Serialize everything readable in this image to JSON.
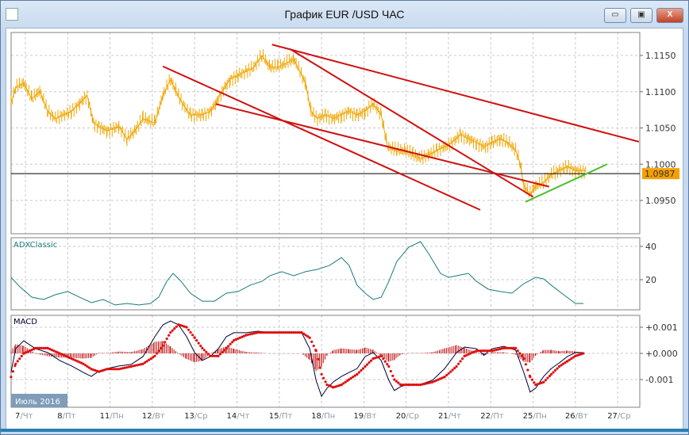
{
  "window": {
    "title": "График EUR /USD  ЧАС",
    "minimize": "▭",
    "maximize": "▣",
    "close": "X"
  },
  "month_label": "Июль 2016",
  "x_axis": [
    {
      "d": 0,
      "day": "7",
      "wd": "/Чт"
    },
    {
      "d": 1,
      "day": "8",
      "wd": "/Пт"
    },
    {
      "d": 2,
      "day": "11",
      "wd": "/Пн"
    },
    {
      "d": 3,
      "day": "12",
      "wd": "/Вт"
    },
    {
      "d": 4,
      "day": "13",
      "wd": "/Ср"
    },
    {
      "d": 5,
      "day": "14",
      "wd": "/Чт"
    },
    {
      "d": 6,
      "day": "15",
      "wd": "/Пт"
    },
    {
      "d": 7,
      "day": "18",
      "wd": "/Пн"
    },
    {
      "d": 8,
      "day": "19",
      "wd": "/Вт"
    },
    {
      "d": 9,
      "day": "20",
      "wd": "/Ср"
    },
    {
      "d": 10,
      "day": "21",
      "wd": "/Чт"
    },
    {
      "d": 11,
      "day": "22",
      "wd": "/Пт"
    },
    {
      "d": 12,
      "day": "25",
      "wd": "/Пн"
    },
    {
      "d": 13,
      "day": "26",
      "wd": "/Вт"
    },
    {
      "d": 14,
      "day": "27",
      "wd": "/Ср"
    }
  ],
  "chart_data": [
    {
      "type": "line",
      "title": "EUR/USD H1",
      "ylim": [
        1.0915,
        1.1175
      ],
      "y_ticks": [
        "1.1150",
        "1.1100",
        "1.1050",
        "1.1000",
        "1.0950"
      ],
      "y_tick_values": [
        1.115,
        1.11,
        1.105,
        1.1,
        1.095
      ],
      "current_price": "1.0987",
      "current_value": 1.0987,
      "colors": {
        "price": "#f0a500",
        "trend": "#d01010",
        "support": "#4cc02c",
        "current": "#000000"
      },
      "x": [
        -0.34,
        -0.23,
        -0.04,
        0.15,
        0.34,
        0.53,
        0.71,
        0.9,
        1.09,
        1.28,
        1.46,
        1.61,
        1.74,
        1.93,
        2.21,
        2.4,
        2.59,
        2.78,
        3.06,
        3.25,
        3.43,
        3.56,
        3.71,
        3.9,
        4.18,
        4.37,
        4.5,
        4.65,
        4.84,
        5.03,
        5.22,
        5.4,
        5.59,
        5.78,
        5.97,
        6.15,
        6.34,
        6.49,
        6.62,
        6.75,
        6.9,
        7.09,
        7.28,
        7.47,
        7.65,
        7.84,
        8.03,
        8.22,
        8.41,
        8.56,
        8.78,
        8.97,
        9.16,
        9.34,
        9.53,
        9.72,
        9.91,
        10.09,
        10.28,
        10.47,
        10.66,
        10.84,
        11.03,
        11.22,
        11.41,
        11.59,
        11.69,
        11.78,
        11.93,
        12.06,
        12.25,
        12.43,
        12.62,
        12.81,
        13.0,
        13.25
      ],
      "y": [
        1.1084,
        1.1106,
        1.1112,
        1.109,
        1.1101,
        1.1073,
        1.1063,
        1.1068,
        1.1073,
        1.1084,
        1.1095,
        1.1057,
        1.1052,
        1.1046,
        1.1052,
        1.1035,
        1.1046,
        1.1063,
        1.1057,
        1.1095,
        1.1117,
        1.1101,
        1.1084,
        1.1068,
        1.1068,
        1.1073,
        1.1084,
        1.1101,
        1.1117,
        1.1123,
        1.1128,
        1.1134,
        1.115,
        1.1134,
        1.1134,
        1.1139,
        1.1145,
        1.1128,
        1.1112,
        1.1073,
        1.1063,
        1.1068,
        1.1063,
        1.1068,
        1.1073,
        1.1068,
        1.1073,
        1.1084,
        1.1068,
        1.1024,
        1.1019,
        1.1019,
        1.1013,
        1.1008,
        1.1013,
        1.1019,
        1.1024,
        1.103,
        1.1041,
        1.1035,
        1.103,
        1.1024,
        1.103,
        1.1035,
        1.103,
        1.1019,
        1.1002,
        1.097,
        1.0959,
        1.097,
        1.0975,
        1.0986,
        1.0991,
        1.0997,
        1.0991,
        1.0991
      ],
      "trendlines": [
        {
          "name": "resistance-1",
          "color": "red",
          "from": [
            3.25,
            1.1135
          ],
          "to": [
            10.75,
            1.0937
          ]
        },
        {
          "name": "resistance-2",
          "color": "red",
          "from": [
            4.5,
            1.1083
          ],
          "to": [
            12.38,
            1.0969
          ]
        },
        {
          "name": "resistance-3",
          "color": "red",
          "from": [
            5.83,
            1.1165
          ],
          "to": [
            14.5,
            1.1031
          ]
        },
        {
          "name": "resistance-4",
          "color": "red",
          "from": [
            6.25,
            1.1159
          ],
          "to": [
            12.0,
            1.0955
          ]
        },
        {
          "name": "support",
          "color": "green",
          "from": [
            11.82,
            1.0948
          ],
          "to": [
            13.75,
            1.1
          ]
        }
      ]
    },
    {
      "type": "line",
      "title": "ADXClassic",
      "ylim": [
        0,
        45
      ],
      "y_ticks": [
        "40",
        "20"
      ],
      "y_tick_values": [
        40,
        20
      ],
      "color": "#1a7a7a",
      "x": [
        -0.34,
        -0.13,
        0.15,
        0.43,
        0.71,
        1.0,
        1.28,
        1.56,
        1.84,
        2.12,
        2.4,
        2.68,
        2.96,
        3.15,
        3.34,
        3.49,
        3.68,
        3.9,
        4.18,
        4.47,
        4.75,
        5.03,
        5.31,
        5.59,
        5.78,
        6.06,
        6.34,
        6.62,
        6.9,
        7.19,
        7.47,
        7.65,
        7.84,
        8.03,
        8.22,
        8.41,
        8.59,
        8.78,
        9.06,
        9.34,
        9.53,
        9.81,
        10.0,
        10.19,
        10.47,
        10.66,
        10.94,
        11.22,
        11.5,
        11.78,
        12.06,
        12.25,
        12.43,
        12.72,
        13.0,
        13.19
      ],
      "y": [
        21.4,
        15.7,
        9.5,
        8.1,
        11,
        12.9,
        9.5,
        6.2,
        8.1,
        4.8,
        5.7,
        4.8,
        5.7,
        9.5,
        19,
        23.8,
        19,
        11.9,
        7.1,
        7.1,
        11.9,
        12.9,
        16.7,
        19,
        22.4,
        24.8,
        22.4,
        24.8,
        26.2,
        28.6,
        33.3,
        28.6,
        16.7,
        11.9,
        8.1,
        9.5,
        19,
        31,
        39.5,
        42.9,
        35.7,
        23.8,
        21.4,
        22.4,
        23.8,
        19,
        14.3,
        12.9,
        11.9,
        17.6,
        21.4,
        20.5,
        16.7,
        11,
        5.7,
        5.7
      ]
    },
    {
      "type": "line",
      "title": "MACD",
      "ylim": [
        -0.0021,
        0.0014
      ],
      "y_ticks": [
        "+0.001",
        "+0.000",
        "-0.001"
      ],
      "y_tick_values": [
        0.001,
        0,
        -0.001
      ],
      "colors": {
        "macd": "#000033",
        "signal": "#e01010",
        "histogram": "#c01010"
      },
      "x": [
        -0.34,
        -0.23,
        -0.04,
        0.24,
        0.53,
        0.81,
        1.09,
        1.37,
        1.56,
        1.74,
        1.93,
        2.21,
        2.5,
        2.78,
        3.06,
        3.25,
        3.43,
        3.62,
        3.81,
        4.0,
        4.18,
        4.37,
        4.56,
        4.75,
        4.93,
        5.22,
        5.5,
        5.78,
        6.06,
        6.34,
        6.53,
        6.72,
        6.87,
        7.0,
        7.13,
        7.28,
        7.47,
        7.65,
        7.84,
        8.03,
        8.22,
        8.41,
        8.59,
        8.72,
        8.87,
        9.06,
        9.34,
        9.62,
        9.91,
        10.19,
        10.38,
        10.66,
        10.84,
        11.03,
        11.31,
        11.59,
        11.78,
        11.93,
        12.06,
        12.25,
        12.43,
        12.62,
        12.81,
        13.0,
        13.19
      ],
      "macd": [
        -0.00073,
        0.00018,
        0.00048,
        0.00018,
        3e-05,
        -0.00027,
        -0.00048,
        -0.00073,
        -0.00088,
        -0.00067,
        -0.00058,
        -0.00048,
        -0.00042,
        -0.00012,
        0.00064,
        0.00109,
        0.00124,
        0.00109,
        0.00064,
        3e-05,
        -0.00027,
        -0.00012,
        0.00018,
        0.00064,
        0.00079,
        0.00079,
        0.00085,
        0.00079,
        0.00079,
        0.00079,
        0.00079,
        0.00018,
        -0.00103,
        -0.00164,
        -0.00133,
        -0.00109,
        -0.00088,
        -0.00073,
        -0.00058,
        -0.00012,
        3e-05,
        -0.00027,
        -0.00103,
        -0.00142,
        -0.00127,
        -0.00118,
        -0.00118,
        -0.00103,
        -0.00058,
        3e-05,
        0.00024,
        0.00018,
        -6e-05,
        0.00018,
        0.00027,
        0.00012,
        -0.00073,
        -0.00148,
        -0.00133,
        -0.00088,
        -0.00058,
        -0.00036,
        -0.00012,
        3e-05,
        3e-05
      ],
      "signal": [
        -0.0009,
        -0.0004,
        0.0,
        0.0002,
        0.0002,
        0.0,
        -0.0002,
        -0.0004,
        -0.0006,
        -0.0007,
        -0.0006,
        -0.0006,
        -0.0005,
        -0.0004,
        -0.0001,
        0.0003,
        0.0008,
        0.0011,
        0.001,
        0.0006,
        0.0002,
        -0.0001,
        -0.0001,
        0.0002,
        0.0005,
        0.0007,
        0.0008,
        0.0008,
        0.0008,
        0.0008,
        0.0008,
        0.0006,
        0.0001,
        -0.0008,
        -0.0012,
        -0.0013,
        -0.0012,
        -0.001,
        -0.0008,
        -0.0005,
        -0.0002,
        -0.0001,
        -0.0005,
        -0.001,
        -0.0012,
        -0.0012,
        -0.0012,
        -0.0011,
        -0.0009,
        -0.0005,
        -0.0001,
        0.0001,
        0.0001,
        0.0001,
        0.0002,
        0.0002,
        -0.0002,
        -0.0009,
        -0.0012,
        -0.0011,
        -0.0008,
        -0.0005,
        -0.0003,
        -0.0001,
        0.0
      ]
    }
  ]
}
